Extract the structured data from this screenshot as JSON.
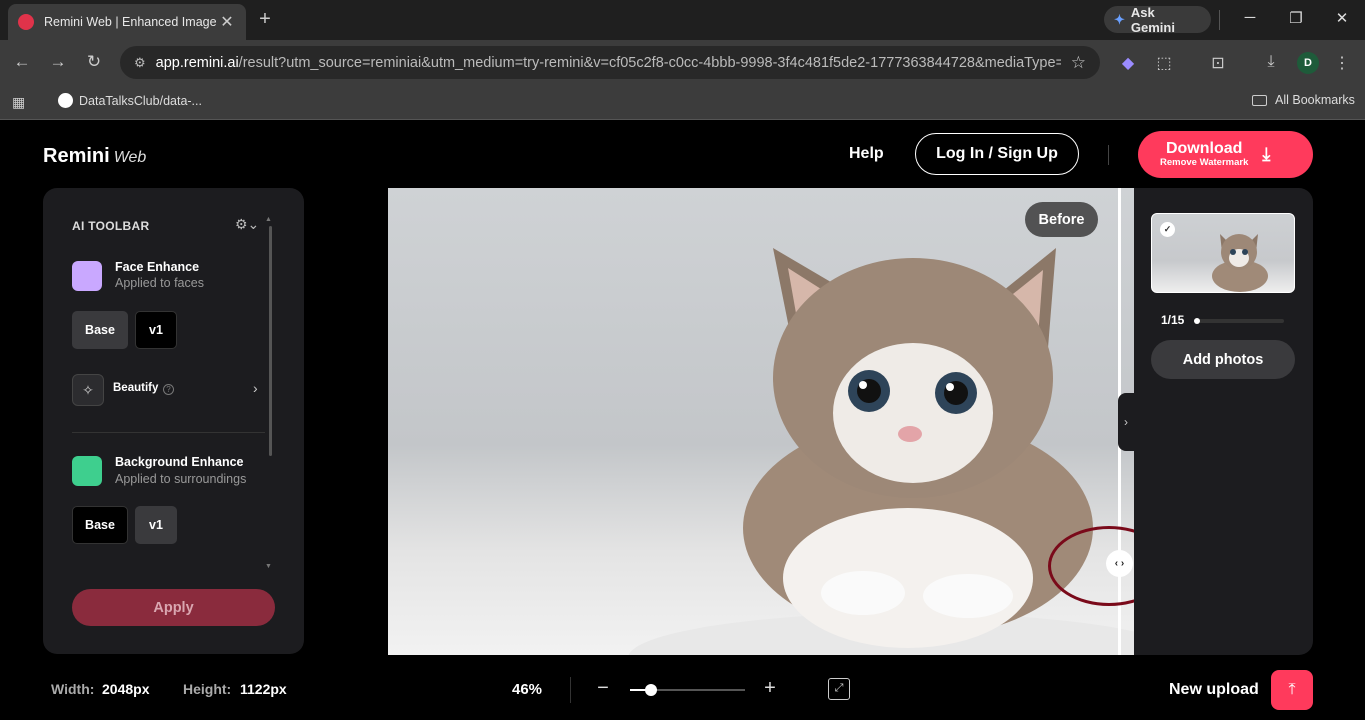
{
  "browser": {
    "tab_title": "Remini Web | Enhanced Image",
    "tab_close": "✕",
    "new_tab": "+",
    "gemini_label": "Ask Gemini",
    "url_host": "app.remini.ai",
    "url_rest": "/result?utm_source=reminiai&utm_medium=try-remini&v=cf05c2f8-c0cc-4bbb-9998-3f4c481f5de2-1777363844728&mediaType=i...",
    "avatar_letter": "D",
    "bookmark_item": "DataTalksClub/data-...",
    "all_bookmarks": "All Bookmarks"
  },
  "header": {
    "logo": "Remini",
    "logo_sub": "Web",
    "help": "Help",
    "login": "Log In / Sign Up",
    "download_main": "Download",
    "download_sub": "Remove Watermark"
  },
  "toolbar_panel": {
    "title": "AI TOOLBAR",
    "face_title": "Face Enhance",
    "face_sub": "Applied to faces",
    "face_options": [
      "Base",
      "v1"
    ],
    "beautify": "Beautify",
    "bg_title": "Background Enhance",
    "bg_sub": "Applied to surroundings",
    "bg_options": [
      "Base",
      "v1"
    ],
    "apply": "Apply"
  },
  "viewer": {
    "before_label": "Before"
  },
  "gallery": {
    "counter": "1/15",
    "progress": 0.067,
    "add_photos": "Add photos"
  },
  "footer": {
    "width_label": "Width:",
    "width_value": "2048px",
    "height_label": "Height:",
    "height_value": "1122px",
    "zoom": "46%",
    "zoom_level": 0.18,
    "new_upload": "New upload"
  },
  "colors": {
    "accent": "#ff3a5c",
    "apply_disabled": "#8a2b3d",
    "panel": "#1c1c1f"
  }
}
